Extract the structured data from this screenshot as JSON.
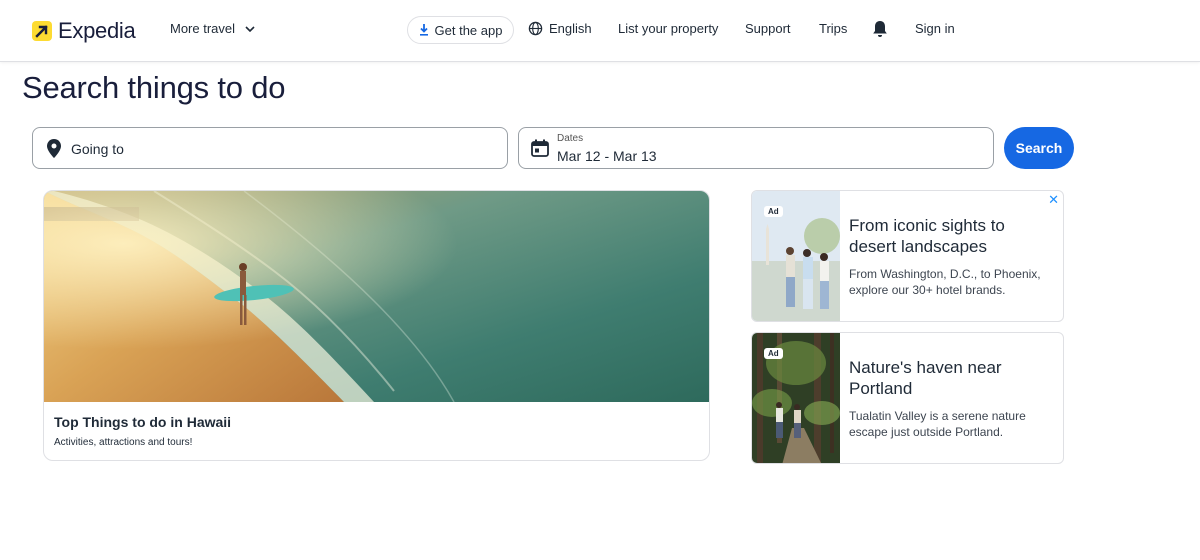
{
  "header": {
    "logo_text": "Expedia",
    "more_travel": "More travel",
    "get_app": "Get the app",
    "language": "English",
    "list_property": "List your property",
    "support": "Support",
    "trips": "Trips",
    "sign_in": "Sign in"
  },
  "page": {
    "title": "Search things to do"
  },
  "search": {
    "going_to_placeholder": "Going to",
    "dates_label": "Dates",
    "dates_value": "Mar 12 - Mar 13",
    "search_label": "Search"
  },
  "hero": {
    "title": "Top Things to do in Hawaii",
    "subtitle": "Activities, attractions and tours!"
  },
  "ads": [
    {
      "badge": "Ad",
      "title": "From iconic sights to desert landscapes",
      "description": "From Washington, D.C., to Phoenix, explore our 30+ hotel brands."
    },
    {
      "badge": "Ad",
      "title": "Nature's haven near Portland",
      "description": "Tualatin Valley is a serene nature escape just outside Portland."
    }
  ],
  "colors": {
    "brand_yellow": "#fddb32",
    "primary_blue": "#1668e3",
    "text_dark": "#191e3b"
  },
  "icons": {
    "logo": "expedia-logo-icon",
    "chevron": "chevron-down-icon",
    "download": "download-icon",
    "globe": "globe-icon",
    "bell": "bell-icon",
    "pin": "location-pin-icon",
    "calendar": "calendar-icon",
    "close": "close-icon"
  }
}
